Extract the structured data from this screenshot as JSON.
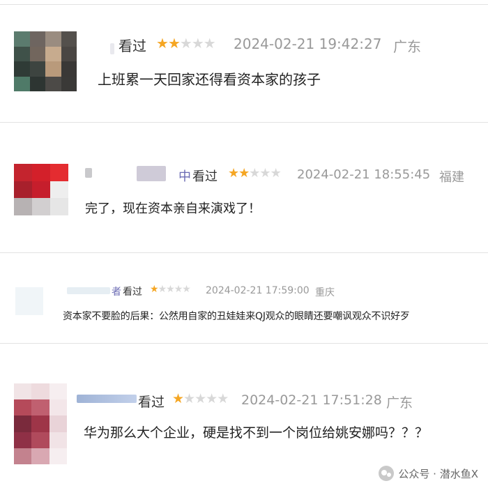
{
  "reviews": [
    {
      "status": "看过",
      "stars": [
        "★",
        "★",
        "★",
        "★",
        "★"
      ],
      "rating": 2,
      "date": "2024-02-21 19:42:27",
      "location": "广东",
      "comment": "上班累一天回家还得看资本家的孩子"
    },
    {
      "status": "看过",
      "name_fragment": "中",
      "stars": [
        "★",
        "★",
        "★",
        "★",
        "★"
      ],
      "rating": 2,
      "date": "2024-02-21 18:55:45",
      "location": "福建",
      "comment": "完了，现在资本亲自来演戏了！"
    },
    {
      "status": "看过",
      "name_fragment": "者",
      "stars": [
        "★",
        "★",
        "★",
        "★",
        "★"
      ],
      "rating": 1,
      "date": "2024-02-21 17:59:00",
      "location": "重庆",
      "comment": "资本家不要脸的后果：公然用自家的丑娃娃来QJ观众的眼睛还要嘲讽观众不识好歹"
    },
    {
      "status": "看过",
      "stars": [
        "★",
        "★",
        "★",
        "★",
        "★"
      ],
      "rating": 1,
      "date": "2024-02-21 17:51:28",
      "location": "广东",
      "comment": "华为那么大个企业，硬是找不到一个岗位给姚安娜吗？？？"
    }
  ],
  "watermark": {
    "text": "公众号 · 潜水鱼X"
  },
  "colors": {
    "star_on": "#f5a623",
    "star_off": "#d8d8d8",
    "meta": "#999999",
    "separator": "#e2e2e2"
  }
}
